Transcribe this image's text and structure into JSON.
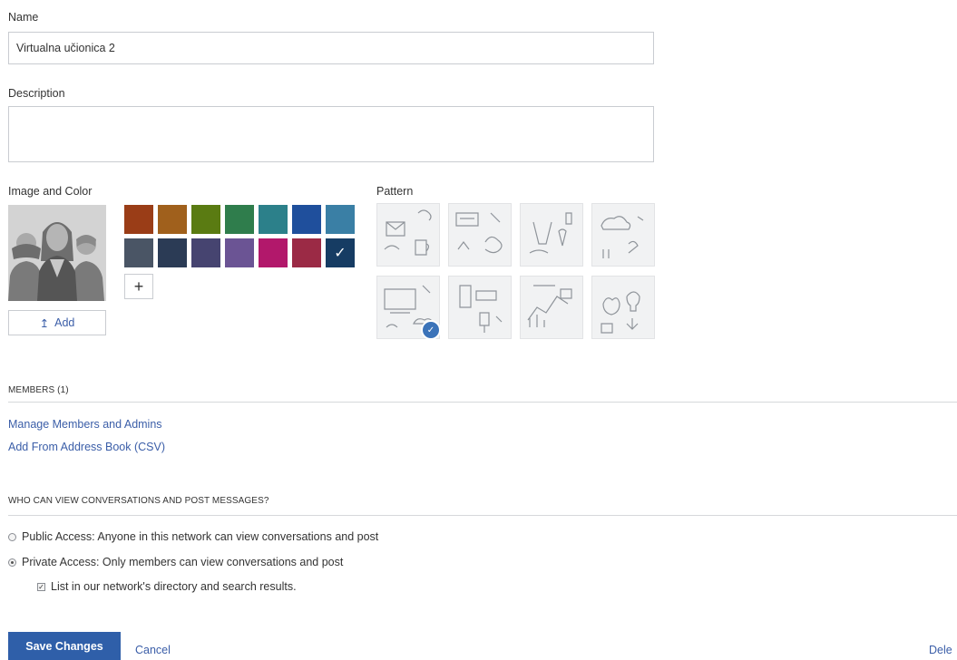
{
  "form": {
    "name_label": "Name",
    "name_value": "Virtualna učionica 2",
    "description_label": "Description",
    "description_value": "",
    "image_color_label": "Image and Color",
    "add_label": "Add",
    "pattern_label": "Pattern"
  },
  "colors": {
    "row1": [
      "#9a3d17",
      "#a0601c",
      "#5a7b12",
      "#2f7d4c",
      "#2c808a",
      "#1f4f9c",
      "#3a7fa5"
    ],
    "row2": [
      "#4a5565",
      "#2b3b55",
      "#464470",
      "#6b5494",
      "#b2186b",
      "#9b2a45",
      "#163c63"
    ],
    "selected": "#163c63"
  },
  "patterns": {
    "icons": [
      "pattern-mail-coffee",
      "pattern-code-brain",
      "pattern-science-flask",
      "pattern-cloud-nature",
      "pattern-computer-cloud",
      "pattern-chat-bulb",
      "pattern-chart-graph",
      "pattern-apple-bulb"
    ],
    "selected_index": 4
  },
  "members": {
    "title": "MEMBERS (1)",
    "manage_link": "Manage Members and Admins",
    "csv_link": "Add From Address Book (CSV)"
  },
  "access": {
    "title": "WHO CAN VIEW CONVERSATIONS AND POST MESSAGES?",
    "public_label": "Public Access: Anyone in this network can view conversations and post",
    "private_label": "Private Access: Only members can view conversations and post",
    "directory_label": "List in our network's directory and search results.",
    "selected": "private",
    "list_in_directory": true
  },
  "footer": {
    "save_label": "Save Changes",
    "cancel_label": "Cancel",
    "delete_label": "Dele"
  }
}
